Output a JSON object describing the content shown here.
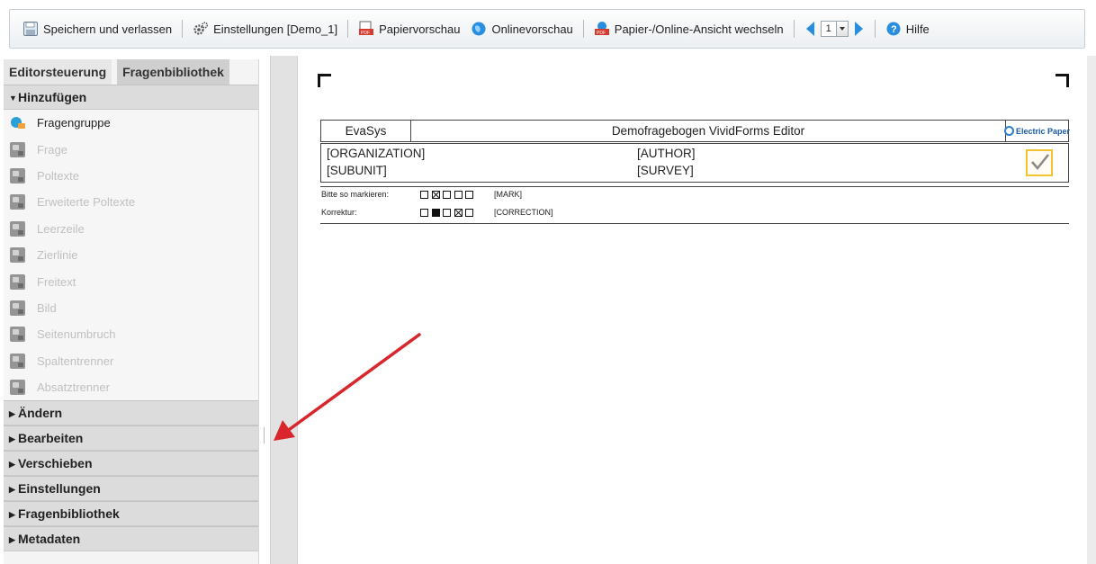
{
  "toolbar": {
    "save_label": "Speichern und verlassen",
    "settings_label": "Einstellungen [Demo_1]",
    "paper_preview_label": "Papiervorschau",
    "online_preview_label": "Onlinevorschau",
    "switch_view_label": "Papier-/Online-Ansicht wechseln",
    "page_value": "1",
    "help_label": "Hilfe"
  },
  "sidebar": {
    "tabs": [
      {
        "label": "Editorsteuerung",
        "active": false
      },
      {
        "label": "Fragenbibliothek",
        "active": true
      }
    ],
    "sections": [
      {
        "label": "Hinzufügen",
        "expanded": true
      },
      {
        "label": "Ändern",
        "expanded": false
      },
      {
        "label": "Bearbeiten",
        "expanded": false
      },
      {
        "label": "Verschieben",
        "expanded": false
      },
      {
        "label": "Einstellungen",
        "expanded": false
      },
      {
        "label": "Fragenbibliothek",
        "expanded": false
      },
      {
        "label": "Metadaten",
        "expanded": false
      }
    ],
    "add_items": [
      {
        "label": "Fragengruppe",
        "enabled": true,
        "icon": "question-group-icon"
      },
      {
        "label": "Frage",
        "enabled": false,
        "icon": "question-icon"
      },
      {
        "label": "Poltexte",
        "enabled": false,
        "icon": "pole-text-icon"
      },
      {
        "label": "Erweiterte Poltexte",
        "enabled": false,
        "icon": "extended-pole-text-icon"
      },
      {
        "label": "Leerzeile",
        "enabled": false,
        "icon": "blank-line-icon"
      },
      {
        "label": "Zierlinie",
        "enabled": false,
        "icon": "decorative-line-icon"
      },
      {
        "label": "Freitext",
        "enabled": false,
        "icon": "free-text-icon"
      },
      {
        "label": "Bild",
        "enabled": false,
        "icon": "image-icon"
      },
      {
        "label": "Seitenumbruch",
        "enabled": false,
        "icon": "page-break-icon"
      },
      {
        "label": "Spaltentrenner",
        "enabled": false,
        "icon": "column-separator-icon"
      },
      {
        "label": "Absatztrenner",
        "enabled": false,
        "icon": "paragraph-separator-icon"
      }
    ]
  },
  "document": {
    "header": {
      "left": "EvaSys",
      "center": "Demofragebogen VividForms Editor",
      "logo_text": "Electric Paper"
    },
    "info": {
      "organization": "[ORGANIZATION]",
      "author": "[AUTHOR]",
      "subunit": "[SUBUNIT]",
      "survey": "[SURVEY]"
    },
    "mark_row": {
      "label": "Bitte so markieren:",
      "placeholder": "[MARK]"
    },
    "correction_row": {
      "label": "Korrektur:",
      "placeholder": "[CORRECTION]"
    }
  },
  "colors": {
    "accent_blue": "#2a8ee0",
    "check_yellow": "#f2c230",
    "arrow_red": "#d9262c"
  }
}
